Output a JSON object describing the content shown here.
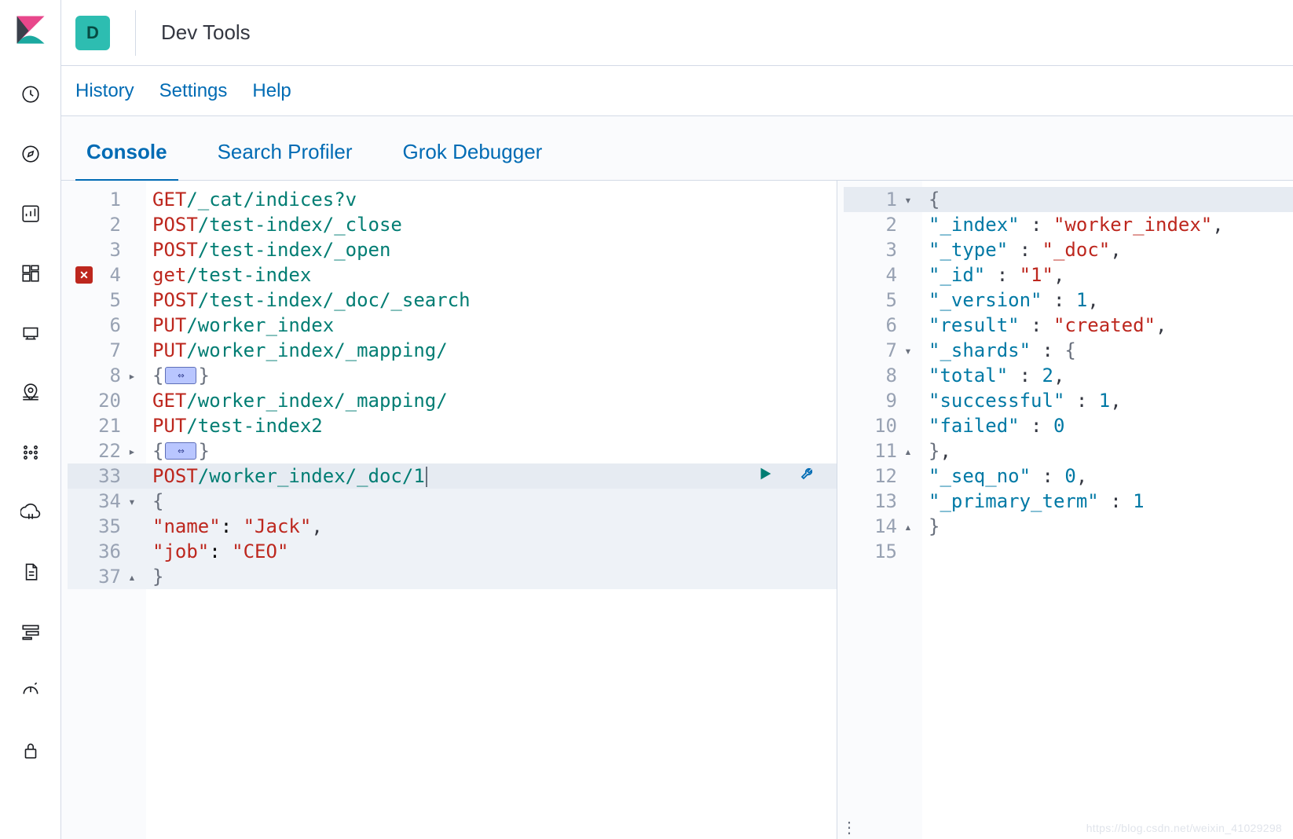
{
  "header": {
    "badge_letter": "D",
    "title": "Dev Tools"
  },
  "subnav": {
    "history": "History",
    "settings": "Settings",
    "help": "Help"
  },
  "tabs": {
    "console": "Console",
    "search_profiler": "Search Profiler",
    "grok_debugger": "Grok Debugger"
  },
  "request": {
    "lines": [
      {
        "n": "1",
        "method": "GET",
        "path": "/_cat/indices?v"
      },
      {
        "n": "2",
        "method": "POST",
        "path": "/test-index/_close"
      },
      {
        "n": "3",
        "method": "POST",
        "path": "/test-index/_open"
      },
      {
        "n": "4",
        "method": "get",
        "path": "/test-index",
        "error": true
      },
      {
        "n": "5",
        "method": "POST",
        "path": "/test-index/_doc/_search"
      },
      {
        "n": "6",
        "method": "PUT",
        "path": "/worker_index"
      },
      {
        "n": "7",
        "method": "PUT",
        "path": "/worker_index/_mapping/"
      },
      {
        "n": "8",
        "folded": true,
        "fold_open": "▸"
      },
      {
        "n": "20",
        "method": "GET",
        "path": "/worker_index/_mapping/"
      },
      {
        "n": "21",
        "method": "PUT",
        "path": "/test-index2"
      },
      {
        "n": "22",
        "folded": true,
        "fold_open": "▸"
      },
      {
        "n": "33",
        "method": "POST",
        "path": "/worker_index/_doc/1",
        "active": true,
        "cursor": true
      },
      {
        "n": "34",
        "raw_open_brace": true,
        "fold_open": "▾",
        "block": true
      },
      {
        "n": "35",
        "kv_key": "\"name\"",
        "kv_sep": ": ",
        "kv_val": "\"Jack\"",
        "tail": ",",
        "indent": 1,
        "block": true
      },
      {
        "n": "36",
        "kv_key": "\"job\"",
        "kv_sep": ": ",
        "kv_val": "\"CEO\"",
        "indent": 1,
        "block": true
      },
      {
        "n": "37",
        "raw_close_brace": true,
        "fold_open": "▴",
        "block": true
      }
    ]
  },
  "response": {
    "lines": [
      {
        "n": "1",
        "text_open_brace": true,
        "fold": "▾",
        "hl": true
      },
      {
        "n": "2",
        "k": "\"_index\"",
        "v": "\"worker_index\"",
        "vtype": "string",
        "tail": ","
      },
      {
        "n": "3",
        "k": "\"_type\"",
        "v": "\"_doc\"",
        "vtype": "string",
        "tail": ","
      },
      {
        "n": "4",
        "k": "\"_id\"",
        "v": "\"1\"",
        "vtype": "string",
        "tail": ","
      },
      {
        "n": "5",
        "k": "\"_version\"",
        "v": "1",
        "vtype": "num",
        "tail": ","
      },
      {
        "n": "6",
        "k": "\"result\"",
        "v": "\"created\"",
        "vtype": "string",
        "tail": ","
      },
      {
        "n": "7",
        "k": "\"_shards\"",
        "open_obj": true,
        "fold": "▾"
      },
      {
        "n": "8",
        "k": "\"total\"",
        "v": "2",
        "vtype": "num",
        "tail": ",",
        "indent": 1
      },
      {
        "n": "9",
        "k": "\"successful\"",
        "v": "1",
        "vtype": "num",
        "tail": ",",
        "indent": 1
      },
      {
        "n": "10",
        "k": "\"failed\"",
        "v": "0",
        "vtype": "num",
        "indent": 1
      },
      {
        "n": "11",
        "close_obj": true,
        "tail": ",",
        "fold": "▴"
      },
      {
        "n": "12",
        "k": "\"_seq_no\"",
        "v": "0",
        "vtype": "num",
        "tail": ","
      },
      {
        "n": "13",
        "k": "\"_primary_term\"",
        "v": "1",
        "vtype": "num"
      },
      {
        "n": "14",
        "text_close_brace": true,
        "fold": "▴"
      },
      {
        "n": "15"
      }
    ]
  },
  "watermark": "https://blog.csdn.net/weixin_41029298"
}
